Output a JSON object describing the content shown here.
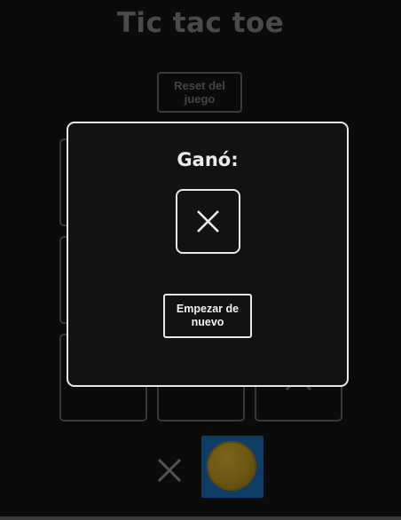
{
  "game": {
    "title": "Tic tac toe",
    "reset_label": "Reset del juego"
  },
  "board": {
    "cells": [
      "",
      "",
      "",
      "",
      "",
      "",
      "",
      "",
      "X"
    ]
  },
  "turn": {
    "players": [
      "X",
      "O"
    ],
    "active": "O"
  },
  "modal": {
    "title": "Ganó:",
    "winner": "X",
    "new_game_label": "Empezar de nuevo"
  },
  "colors": {
    "background": "#0b0b0b",
    "modal_border": "#e8e8e8",
    "active_turn_bg": "#0f3d66",
    "o_token": "#6b5612"
  }
}
